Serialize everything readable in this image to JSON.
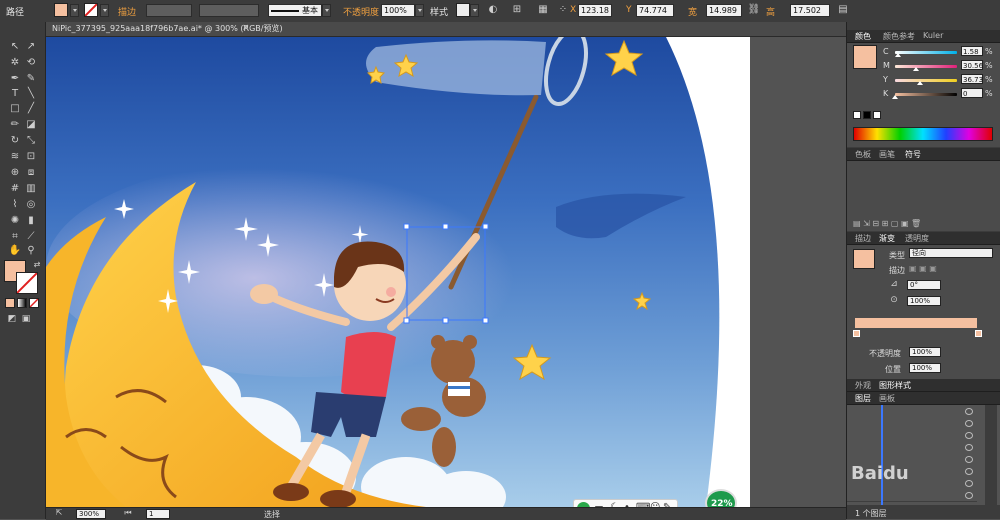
{
  "control_bar": {
    "selection_label": "路径",
    "stroke_label": "描边",
    "stroke_style": "基本",
    "opacity_label": "不透明度",
    "opacity_value": "100%",
    "style_label": "样式",
    "x_label": "X",
    "x_value": "123.18",
    "y_label": "Y",
    "y_value": "74.774",
    "w_label": "宽",
    "w_value": "14.989",
    "h_label": "高",
    "h_value": "17.502",
    "fill_color": "#f5c0a0"
  },
  "document": {
    "tab_title": "NiPic_377395_925aaa18f796b7ae.ai* @ 300% (RGB/预览)",
    "close_glyph": "×"
  },
  "status_bar": {
    "zoom": "300%",
    "page": "1",
    "tool_name": "选择"
  },
  "ime_toolbar": {
    "mode_label": "五",
    "progress_percent": "22%"
  },
  "panels": {
    "color": {
      "tabs": [
        "颜色",
        "颜色参考",
        "Kuler"
      ],
      "channels": [
        {
          "name": "C",
          "value": "1.58",
          "unit": "%"
        },
        {
          "name": "M",
          "value": "30.56",
          "unit": "%"
        },
        {
          "name": "Y",
          "value": "36.73",
          "unit": "%"
        },
        {
          "name": "K",
          "value": "0",
          "unit": "%"
        }
      ],
      "swatch": "#f5c0a0"
    },
    "swatches": {
      "tabs": [
        "色板",
        "画笔",
        "符号"
      ]
    },
    "gradient": {
      "tabs": [
        "描边",
        "渐变",
        "透明度"
      ],
      "type_label": "类型",
      "type_value": "径向",
      "stroke_label": "描边",
      "angle_value": "0°",
      "ratio_value": "100%",
      "opacity_label": "不透明度",
      "opacity_value": "100%",
      "location_label": "位置",
      "location_value": "100%"
    },
    "appearance": {
      "tabs": [
        "外观",
        "图形样式"
      ]
    },
    "layers": {
      "tabs": [
        "图层",
        "画板"
      ],
      "footer": "1 个图层",
      "watermark": "Baidu"
    }
  }
}
